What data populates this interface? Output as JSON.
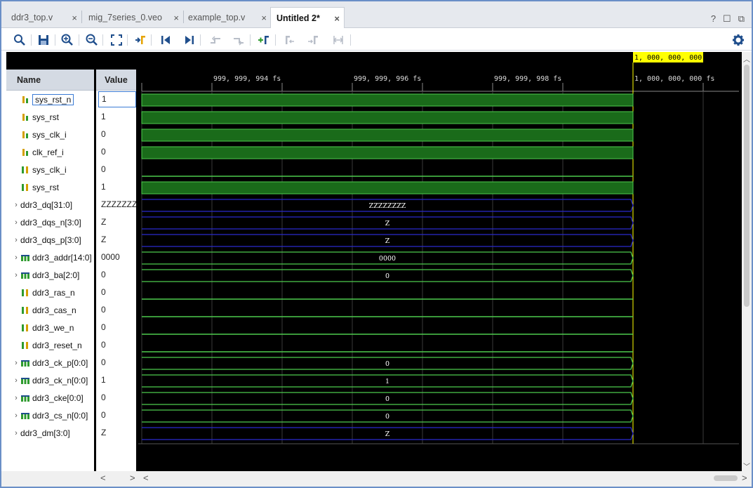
{
  "tabs": [
    {
      "label": "ddr3_top.v",
      "active": false
    },
    {
      "label": "mig_7series_0.veo",
      "active": false
    },
    {
      "label": "example_top.v",
      "active": false
    },
    {
      "label": "Untitled 2*",
      "active": true
    }
  ],
  "tab_close_glyph": "×",
  "window_controls": {
    "help": "?",
    "restore": "☐",
    "popout": "⧉"
  },
  "toolbar_icons": [
    "search-icon",
    "save-icon",
    "zoom-in-icon",
    "zoom-out-icon",
    "zoom-fit-icon",
    "go-to-cursor-icon",
    "go-to-time-0-icon",
    "go-to-last-time-icon",
    "previous-transition-icon",
    "next-transition-icon",
    "add-marker-icon",
    "previous-marker-icon",
    "next-marker-icon",
    "swap-cursors-icon",
    "settings-icon"
  ],
  "columns": {
    "name": "Name",
    "value": "Value"
  },
  "signals": [
    {
      "name": "sys_rst_n",
      "value": "1",
      "type": "bit",
      "expandable": false,
      "wave": "high",
      "selected": true
    },
    {
      "name": "sys_rst",
      "value": "1",
      "type": "bit",
      "expandable": false,
      "wave": "high"
    },
    {
      "name": "sys_clk_i",
      "value": "0",
      "type": "bit",
      "expandable": false,
      "wave": "high"
    },
    {
      "name": "clk_ref_i",
      "value": "0",
      "type": "bit",
      "expandable": false,
      "wave": "high"
    },
    {
      "name": "sys_clk_i",
      "value": "0",
      "type": "wire",
      "expandable": false,
      "wave": "low"
    },
    {
      "name": "sys_rst",
      "value": "1",
      "type": "wire",
      "expandable": false,
      "wave": "high"
    },
    {
      "name": "ddr3_dq[31:0]",
      "value": "ZZZZZZZZ",
      "type": "bus-z",
      "expandable": true,
      "wave": "bus-z",
      "bus_label": "ZZZZZZZZ"
    },
    {
      "name": "ddr3_dqs_n[3:0]",
      "value": "Z",
      "type": "bus-z",
      "expandable": true,
      "wave": "bus-z",
      "bus_label": "Z"
    },
    {
      "name": "ddr3_dqs_p[3:0]",
      "value": "Z",
      "type": "bus-z",
      "expandable": true,
      "wave": "bus-z",
      "bus_label": "Z"
    },
    {
      "name": "ddr3_addr[14:0]",
      "value": "0000",
      "type": "bus",
      "expandable": true,
      "wave": "bus",
      "bus_label": "0000"
    },
    {
      "name": "ddr3_ba[2:0]",
      "value": "0",
      "type": "bus",
      "expandable": true,
      "wave": "bus",
      "bus_label": "0"
    },
    {
      "name": "ddr3_ras_n",
      "value": "0",
      "type": "wire",
      "expandable": false,
      "wave": "low"
    },
    {
      "name": "ddr3_cas_n",
      "value": "0",
      "type": "wire",
      "expandable": false,
      "wave": "low"
    },
    {
      "name": "ddr3_we_n",
      "value": "0",
      "type": "wire",
      "expandable": false,
      "wave": "low"
    },
    {
      "name": "ddr3_reset_n",
      "value": "0",
      "type": "wire",
      "expandable": false,
      "wave": "low"
    },
    {
      "name": "ddr3_ck_p[0:0]",
      "value": "0",
      "type": "bus",
      "expandable": true,
      "wave": "bus",
      "bus_label": "0"
    },
    {
      "name": "ddr3_ck_n[0:0]",
      "value": "1",
      "type": "bus",
      "expandable": true,
      "wave": "bus",
      "bus_label": "1"
    },
    {
      "name": "ddr3_cke[0:0]",
      "value": "0",
      "type": "bus",
      "expandable": true,
      "wave": "bus",
      "bus_label": "0"
    },
    {
      "name": "ddr3_cs_n[0:0]",
      "value": "0",
      "type": "bus",
      "expandable": true,
      "wave": "bus",
      "bus_label": "0"
    },
    {
      "name": "ddr3_dm[3:0]",
      "value": "Z",
      "type": "bus-z",
      "expandable": true,
      "wave": "bus-z",
      "bus_label": "Z"
    }
  ],
  "timeline": {
    "cursor_label": "1, 000, 000, 000  fs",
    "ticks": [
      "999, 999, 994  fs",
      "999, 999, 996  fs",
      "999, 999, 998  fs",
      "1, 000, 000, 000  fs"
    ]
  },
  "scroll_glyphs": {
    "up": "︿",
    "down": "﹀",
    "left": "<",
    "right": ">"
  },
  "colors": {
    "wave_green": "#1a6b1a",
    "wave_line": "#4ecb4e",
    "bus_z_line": "#2a2acc",
    "cursor": "#ffff00",
    "grid": "#3a3a3a",
    "background": "#000000"
  }
}
